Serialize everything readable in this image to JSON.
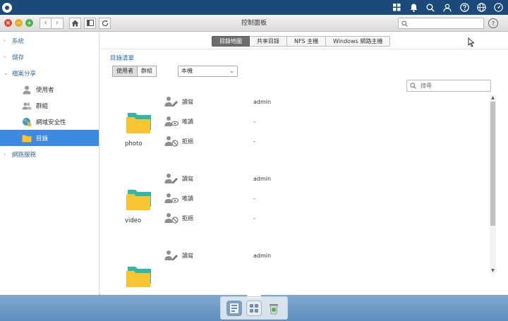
{
  "window": {
    "title": "控制面板",
    "search_placeholder": "",
    "help": "?"
  },
  "sidebar": {
    "items": [
      {
        "label": "系統",
        "chevron": "›"
      },
      {
        "label": "儲存",
        "chevron": "›"
      },
      {
        "label": "檔案分享",
        "chevron": "⌄"
      },
      {
        "label": "網路服務",
        "chevron": "›"
      }
    ],
    "subitems": [
      {
        "label": "使用者"
      },
      {
        "label": "群組"
      },
      {
        "label": "網域安全性"
      },
      {
        "label": "目錄"
      }
    ]
  },
  "tabs": [
    {
      "label": "目錄地圖"
    },
    {
      "label": "共享目錄"
    },
    {
      "label": "NFS 主機"
    },
    {
      "label": "Windows 網路主機"
    }
  ],
  "content": {
    "section_title": "目錄清單",
    "seg_user": "使用者",
    "seg_group": "群組",
    "select_value": "本機",
    "search_placeholder": "搜尋"
  },
  "folders": [
    {
      "name": "photo",
      "perms": [
        {
          "label": "讀寫",
          "value": "admin"
        },
        {
          "label": "唯讀",
          "value": "-"
        },
        {
          "label": "拒絕",
          "value": "-"
        }
      ]
    },
    {
      "name": "video",
      "perms": [
        {
          "label": "讀寫",
          "value": "admin"
        },
        {
          "label": "唯讀",
          "value": "-"
        },
        {
          "label": "拒絕",
          "value": "-"
        }
      ]
    },
    {
      "name": "",
      "perms": [
        {
          "label": "讀寫",
          "value": "admin"
        }
      ]
    }
  ],
  "scrollbar": {
    "up": "▲",
    "down": "▼"
  },
  "colors": {
    "accent": "#3d8ae0",
    "link": "#3b6ea8",
    "folder_yellow": "#f7c432",
    "folder_teal": "#2fb7a7"
  }
}
